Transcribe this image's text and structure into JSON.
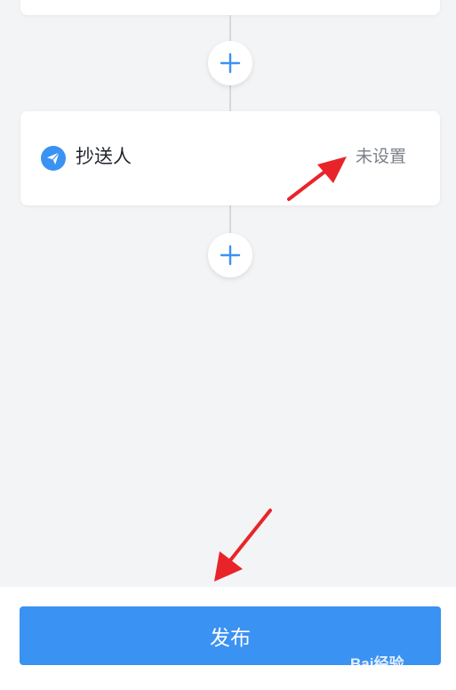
{
  "flow": {
    "cc_node": {
      "title": "抄送人",
      "status": "未设置",
      "icon": "paper-plane-icon",
      "icon_color": "#3a92f2"
    },
    "add_icon": "plus-icon"
  },
  "footer": {
    "publish_label": "发布",
    "button_color": "#3a92f2"
  },
  "annotations": {
    "arrow_color": "#e8242a"
  },
  "watermark": {
    "text": "Bai经验",
    "url": "jingyan.baidu.com"
  }
}
